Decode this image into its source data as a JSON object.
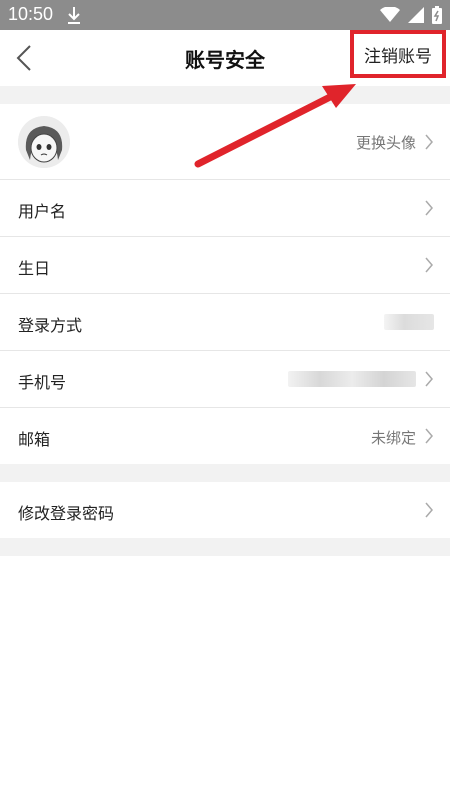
{
  "status_bar": {
    "time": "10:50"
  },
  "nav": {
    "title": "账号安全",
    "cancel_account": "注销账号"
  },
  "rows": {
    "avatar": {
      "value": "更换头像"
    },
    "username": {
      "label": "用户名"
    },
    "birthday": {
      "label": "生日"
    },
    "login_method": {
      "label": "登录方式"
    },
    "phone": {
      "label": "手机号"
    },
    "email": {
      "label": "邮箱",
      "value": "未绑定"
    },
    "change_password": {
      "label": "修改登录密码"
    }
  },
  "colors": {
    "annotation_red": "#e0242b",
    "status_bar": "#8c8c8c",
    "section_gap": "#f2f2f2"
  },
  "icons": [
    "download-icon",
    "wifi-icon",
    "signal-icon",
    "battery-icon",
    "back-chevron-icon",
    "chevron-right-icon"
  ]
}
